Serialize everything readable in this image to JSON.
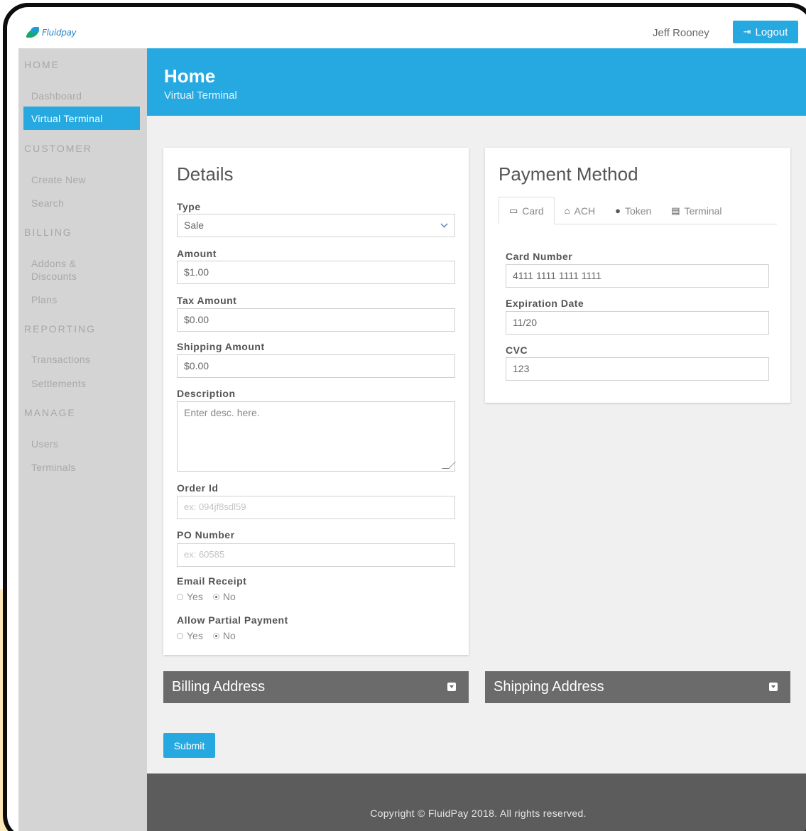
{
  "header": {
    "logo_text": "Fluidpay",
    "user_name": "Jeff Rooney",
    "logout_label": "Logout"
  },
  "sidebar": {
    "sections": [
      {
        "heading": "HOME",
        "items": [
          "Dashboard",
          "Virtual Terminal"
        ]
      },
      {
        "heading": "CUSTOMER",
        "items": [
          "Create New",
          "Search"
        ]
      },
      {
        "heading": "BILLING",
        "items": [
          "Addons &",
          "Discounts",
          "Plans"
        ]
      },
      {
        "heading": "REPORTING",
        "items": [
          "Transactions",
          "Settlements"
        ]
      },
      {
        "heading": "MANAGE",
        "items": [
          "Users",
          "Terminals"
        ]
      }
    ],
    "active_item": "Virtual Terminal"
  },
  "page": {
    "title": "Home",
    "subtitle": "Virtual Terminal"
  },
  "details": {
    "title": "Details",
    "type_label": "Type",
    "type_value": "Sale",
    "amount_label": "Amount",
    "amount_value": "$1.00",
    "tax_label": "Tax Amount",
    "tax_value": "$0.00",
    "shipping_label": "Shipping Amount",
    "shipping_value": "$0.00",
    "description_label": "Description",
    "description_placeholder": "Enter desc. here.",
    "order_label": "Order Id",
    "order_placeholder": "ex: 094jf8sdl59",
    "po_label": "PO Number",
    "po_placeholder": "ex: 60585",
    "email_label": "Email Receipt",
    "partial_label": "Allow Partial Payment",
    "yes": "Yes",
    "no": "No",
    "email_selected": "No",
    "partial_selected": "No"
  },
  "payment": {
    "title": "Payment Method",
    "tabs": [
      "Card",
      "ACH",
      "Token",
      "Terminal"
    ],
    "active_tab": "Card",
    "card_label": "Card Number",
    "card_value": "4111 1111 1111 1111",
    "expiry_label": "Expiration Date",
    "expiry_value": "11/20",
    "cvc_label": "CVC",
    "cvc_value": "123"
  },
  "sections": {
    "billing": "Billing Address",
    "shipping": "Shipping Address"
  },
  "submit_label": "Submit",
  "footer_text": "Copyright © FluidPay 2018. All rights reserved.",
  "colors": {
    "accent": "#26a9e0",
    "sidebar": "#d4d4d4",
    "collapse_bar": "#6b6b6b",
    "footer": "#5c5c5c"
  }
}
